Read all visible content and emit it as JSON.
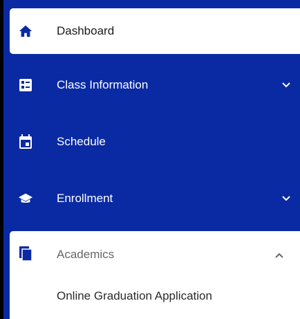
{
  "nav": {
    "items": [
      {
        "label": "Dashboard",
        "icon": "home-icon",
        "active": true
      },
      {
        "label": "Class Information",
        "icon": "class-info-icon",
        "expandable": true
      },
      {
        "label": "Schedule",
        "icon": "calendar-icon"
      },
      {
        "label": "Enrollment",
        "icon": "graduation-cap-icon",
        "expandable": true
      }
    ],
    "academics": {
      "label": "Academics",
      "icon": "documents-icon",
      "expanded": true,
      "subitems": [
        {
          "label": "Online Graduation Application"
        }
      ]
    }
  },
  "colors": {
    "sidebar_bg": "#0a2aa3",
    "active_bg": "#ffffff",
    "icon_dark": "#0a2aa3"
  }
}
